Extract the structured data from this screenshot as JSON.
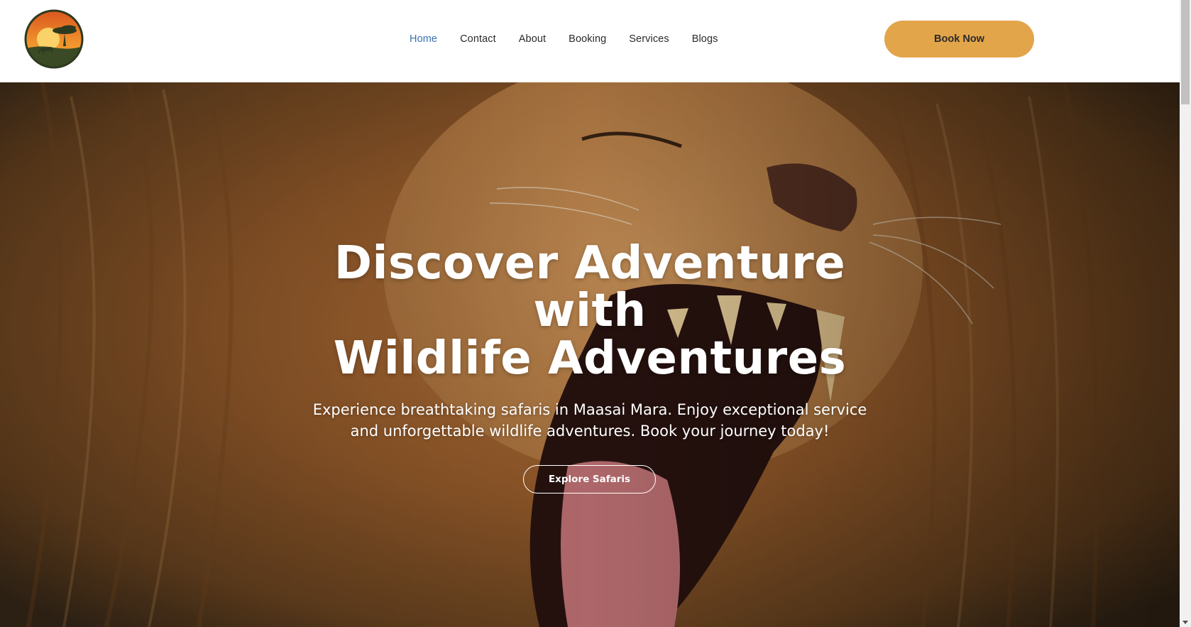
{
  "header": {
    "logo_name": "safari-sunset-logo",
    "nav": [
      {
        "label": "Home",
        "active": true
      },
      {
        "label": "Contact",
        "active": false
      },
      {
        "label": "About",
        "active": false
      },
      {
        "label": "Booking",
        "active": false
      },
      {
        "label": "Services",
        "active": false
      },
      {
        "label": "Blogs",
        "active": false
      }
    ],
    "cta_label": "Book Now"
  },
  "hero": {
    "title_line1": "Discover Adventure",
    "title_line2": "with",
    "title_line3": "Wildlife Adventures",
    "subtitle_line1": "Experience breathtaking safaris in Maasai Mara. Enjoy exceptional service",
    "subtitle_line2": "and unforgettable wildlife adventures. Book your journey today!",
    "button_label": "Explore Safaris",
    "image": "roaring-lion-photo"
  },
  "colors": {
    "accent": "#e3a54a",
    "nav_active": "#3a6fb0",
    "nav_text": "#2a2a2a"
  }
}
